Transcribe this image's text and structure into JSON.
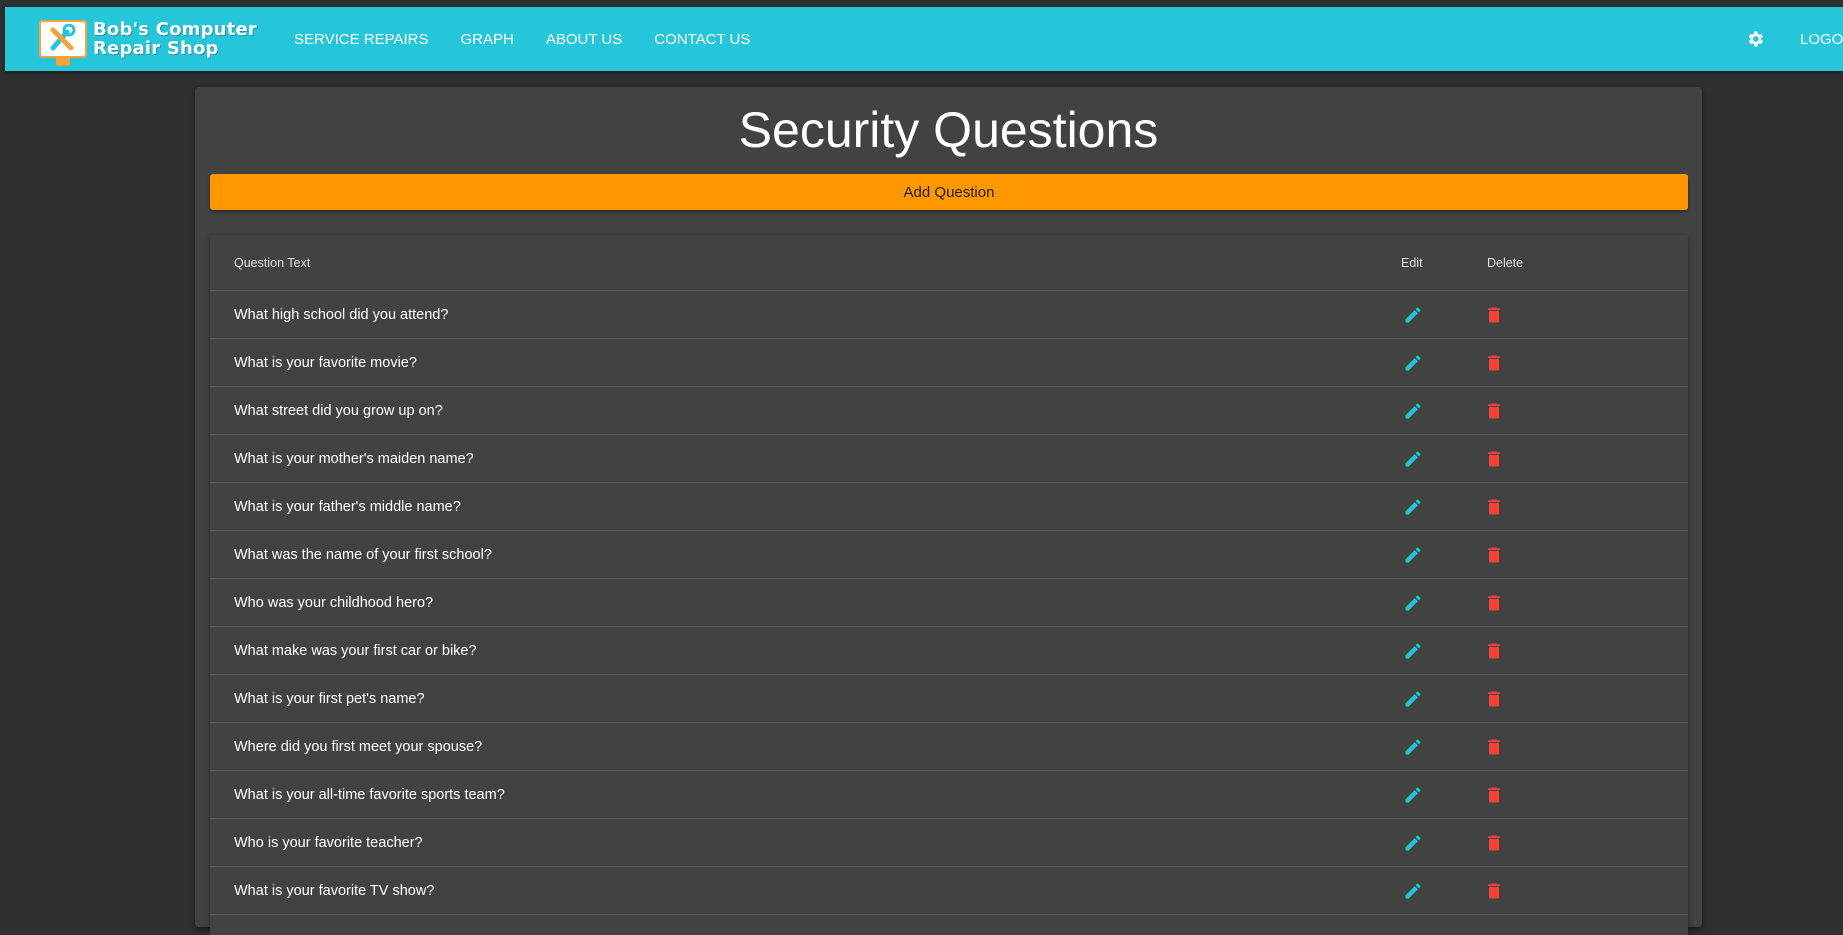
{
  "brand": {
    "line1": "Bob's Computer",
    "line2": "Repair Shop"
  },
  "nav": {
    "links": [
      "SERVICE REPAIRS",
      "GRAPH",
      "ABOUT US",
      "CONTACT US"
    ],
    "logout": "LOGOUT",
    "settings_icon": "gear-icon"
  },
  "page": {
    "title": "Security Questions",
    "add_button": "Add Question"
  },
  "table": {
    "headers": {
      "question": "Question Text",
      "edit": "Edit",
      "delete": "Delete"
    },
    "rows": [
      "What high school did you attend?",
      "What is your favorite movie?",
      "What street did you grow up on?",
      "What is your mother's maiden name?",
      "What is your father's middle name?",
      "What was the name of your first school?",
      "Who was your childhood hero?",
      "What make was your first car or bike?",
      "What is your first pet's name?",
      "Where did you first meet your spouse?",
      "What is your all-time favorite sports team?",
      "Who is your favorite teacher?",
      "What is your favorite TV show?"
    ]
  },
  "colors": {
    "navbar": "#26c6da",
    "accent_button": "#ff9800",
    "edit_icon": "#26c6da",
    "delete_icon": "#f44336",
    "card": "#424242",
    "background": "#2f2f2f"
  }
}
